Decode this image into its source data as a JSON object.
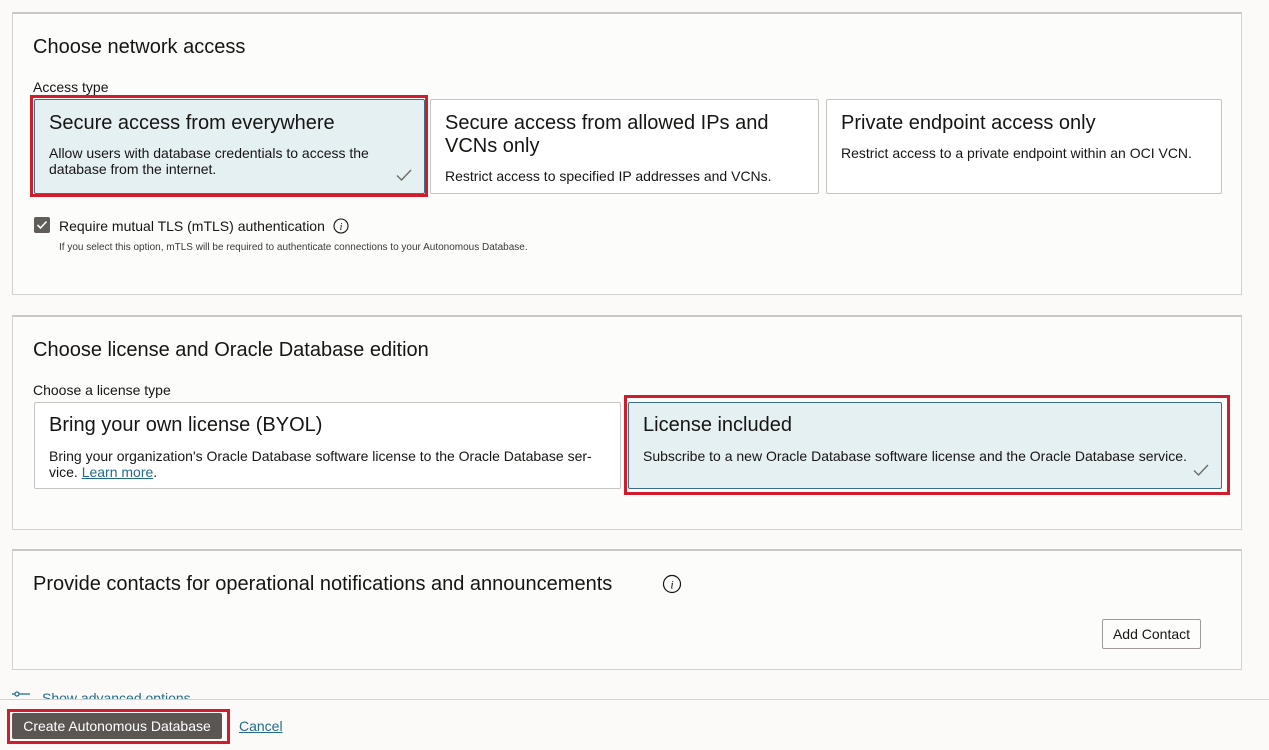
{
  "network": {
    "title": "Choose network access",
    "access_type_label": "Access type",
    "options": [
      {
        "title": "Secure access from everywhere",
        "desc": "Allow users with database credentials to access the database from the internet.",
        "selected": true
      },
      {
        "title": "Secure access from allowed IPs and VCNs only",
        "desc": "Restrict access to specified IP addresses and VCNs.",
        "selected": false
      },
      {
        "title": "Private endpoint access only",
        "desc": "Restrict access to a private endpoint within an OCI VCN.",
        "selected": false
      }
    ],
    "mtls": {
      "label": "Require mutual TLS (mTLS) authentication",
      "checked": true,
      "help": "If you select this option, mTLS will be required to authenticate connections to your Autonomous Database."
    }
  },
  "license": {
    "title": "Choose license and Oracle Database edition",
    "type_label": "Choose a license type",
    "options": [
      {
        "title": "Bring your own license (BYOL)",
        "desc": "Bring your organization's Oracle Database software license to the Oracle Database ser-vice.",
        "link": "Learn more",
        "link_suffix": ".",
        "selected": false
      },
      {
        "title": "License included",
        "desc": "Subscribe to a new Oracle Database software license and the Oracle Database service.",
        "selected": true
      }
    ]
  },
  "contacts": {
    "title": "Provide contacts for operational notifications and announcements",
    "add_contact": "Add Contact"
  },
  "advanced": {
    "label": "Show advanced options"
  },
  "footer": {
    "create_label": "Create Autonomous Database",
    "cancel_label": "Cancel"
  },
  "colors": {
    "highlight": "#d01c2c",
    "selected_tile_bg": "#e4f0f2",
    "link": "#226c8a",
    "primary_button": "#5b5652"
  }
}
